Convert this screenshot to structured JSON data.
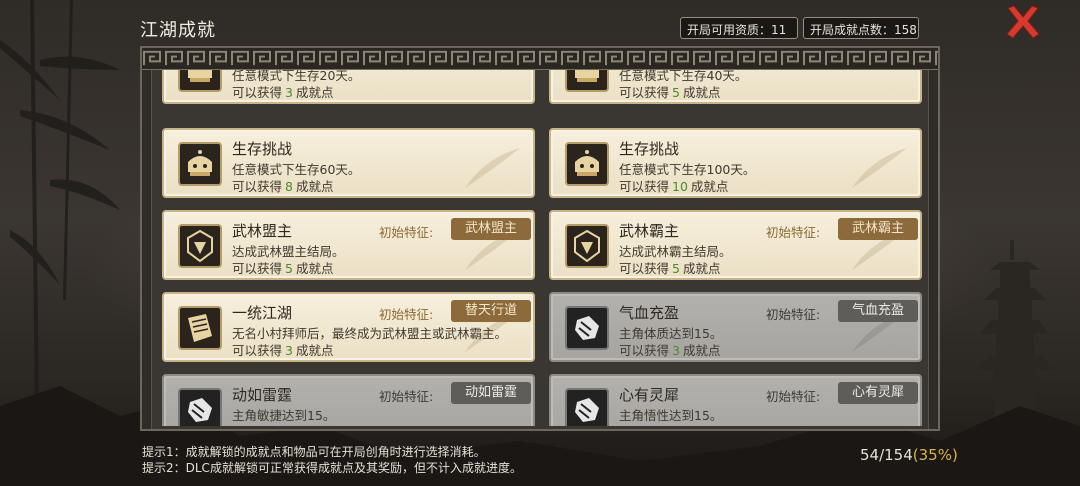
{
  "header": {
    "title": "江湖成就",
    "available_label": "开局可用资质：",
    "available_value": "11",
    "points_label": "开局成就点数：",
    "points_value": "158"
  },
  "cards": [
    {
      "title": "",
      "desc": "任意模式下生存20天。",
      "reward_prefix": "可以获得",
      "points": "3",
      "reward_suffix": "成就点",
      "icon": "helmet-icon",
      "locked": false
    },
    {
      "title": "",
      "desc": "任意模式下生存40天。",
      "reward_prefix": "可以获得",
      "points": "5",
      "reward_suffix": "成就点",
      "icon": "helmet-icon",
      "locked": false
    },
    {
      "title": "生存挑战",
      "desc": "任意模式下生存60天。",
      "reward_prefix": "可以获得",
      "points": "8",
      "reward_suffix": "成就点",
      "icon": "helmet-icon",
      "locked": false
    },
    {
      "title": "生存挑战",
      "desc": "任意模式下生存100天。",
      "reward_prefix": "可以获得",
      "points": "10",
      "reward_suffix": "成就点",
      "icon": "helmet-icon",
      "locked": false
    },
    {
      "title": "武林盟主",
      "desc": "达成武林盟主结局。",
      "reward_prefix": "可以获得",
      "points": "5",
      "reward_suffix": "成就点",
      "icon": "emblem-icon",
      "locked": false,
      "trait_label": "初始特征:",
      "trait": "武林盟主"
    },
    {
      "title": "武林霸主",
      "desc": "达成武林霸主结局。",
      "reward_prefix": "可以获得",
      "points": "5",
      "reward_suffix": "成就点",
      "icon": "emblem-icon",
      "locked": false,
      "trait_label": "初始特征:",
      "trait": "武林霸主"
    },
    {
      "title": "一统江湖",
      "desc": "无名小村拜师后，最终成为武林盟主或武林霸主。",
      "reward_prefix": "可以获得",
      "points": "3",
      "reward_suffix": "成就点",
      "icon": "scroll-icon",
      "locked": false,
      "trait_label": "初始特征:",
      "trait": "替天行道"
    },
    {
      "title": "气血充盈",
      "desc": "主角体质达到15。",
      "reward_prefix": "可以获得",
      "points": "3",
      "reward_suffix": "成就点",
      "icon": "fist-icon",
      "locked": true,
      "trait_label": "初始特征:",
      "trait": "气血充盈"
    },
    {
      "title": "动如雷霆",
      "desc": "主角敏捷达到15。",
      "reward_prefix": "",
      "points": "",
      "reward_suffix": "",
      "icon": "fist-icon",
      "locked": true,
      "trait_label": "初始特征:",
      "trait": "动如雷霆"
    },
    {
      "title": "心有灵犀",
      "desc": "主角悟性达到15。",
      "reward_prefix": "",
      "points": "",
      "reward_suffix": "",
      "icon": "fist-icon",
      "locked": true,
      "trait_label": "初始特征:",
      "trait": "心有灵犀"
    }
  ],
  "footer": {
    "hint1": "提示1：成就解锁的成就点和物品可在开局创角时进行选择消耗。",
    "hint2": "提示2：DLC成就解锁可正常获得成就点及其奖励，但不计入成就进度。",
    "progress_count": "54/154",
    "progress_percent": "(35%)",
    "progress_fraction": 0.35
  },
  "colors": {
    "card_bg": "#f1e8d1",
    "card_locked_bg": "#aeadaa",
    "points_green": "#4f8a2a",
    "trait_btn": "#8c6a3c",
    "close_red": "#d63a2f",
    "percent_gold": "#d9b44a"
  }
}
